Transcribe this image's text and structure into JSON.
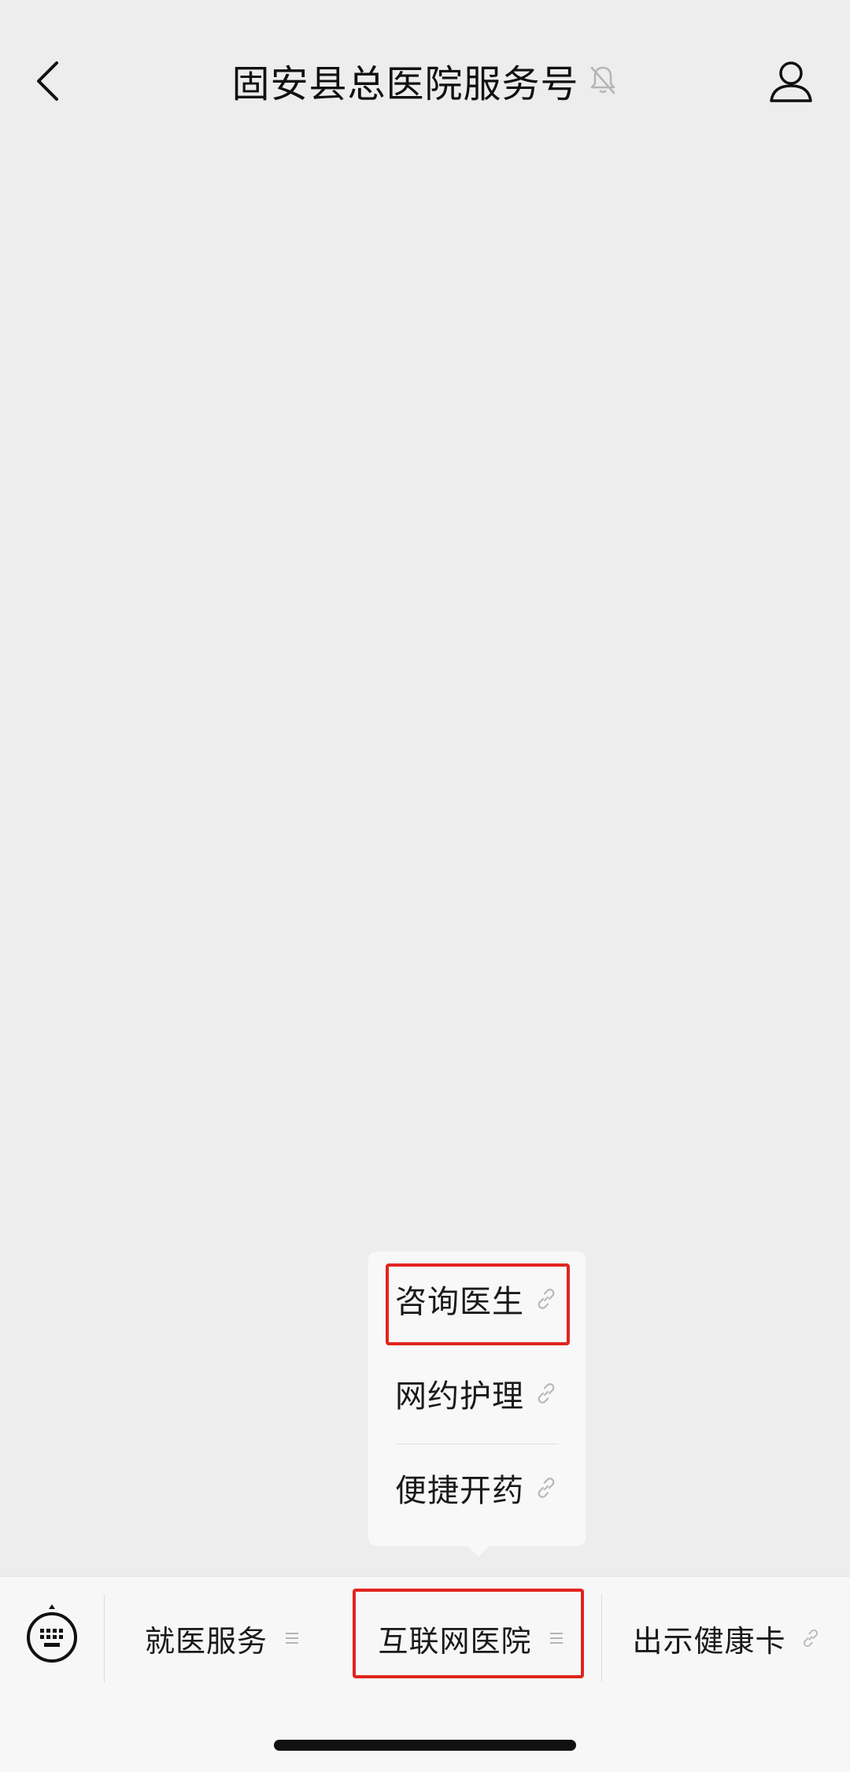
{
  "header": {
    "title": "固安县总医院服务号",
    "back_icon": "chevron-left-icon",
    "mute_icon": "bell-muted-icon",
    "profile_icon": "user-icon"
  },
  "popup_menu": {
    "items": [
      {
        "label": "咨询医生",
        "icon": "link-icon"
      },
      {
        "label": "网约护理",
        "icon": "link-icon"
      },
      {
        "label": "便捷开药",
        "icon": "link-icon"
      }
    ]
  },
  "bottom_bar": {
    "keyboard_icon": "keyboard-icon",
    "tabs": [
      {
        "label": "就医服务",
        "icon": "submenu-icon"
      },
      {
        "label": "互联网医院",
        "icon": "submenu-icon"
      },
      {
        "label": "出示健康卡",
        "icon": "link-icon"
      }
    ]
  },
  "colors": {
    "background": "#ededed",
    "bar_background": "#f7f7f7",
    "highlight": "#e0251e"
  }
}
